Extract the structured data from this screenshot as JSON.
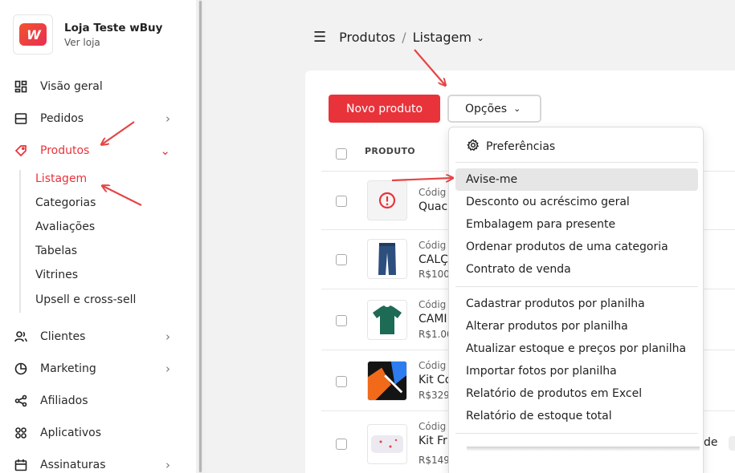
{
  "store": {
    "name": "Loja Teste wBuy",
    "link": "Ver loja",
    "logo_text": "W"
  },
  "nav": {
    "items": [
      {
        "label": "Visão geral",
        "icon": "dashboard-icon"
      },
      {
        "label": "Pedidos",
        "icon": "orders-icon",
        "chevron": "›"
      },
      {
        "label": "Produtos",
        "icon": "tag-icon",
        "chevron": "⌄"
      },
      {
        "label": "Clientes",
        "icon": "users-icon",
        "chevron": "›"
      },
      {
        "label": "Marketing",
        "icon": "pie-chart-icon",
        "chevron": "›"
      },
      {
        "label": "Afiliados",
        "icon": "share-icon"
      },
      {
        "label": "Aplicativos",
        "icon": "apps-icon"
      },
      {
        "label": "Assinaturas",
        "icon": "calendar-icon",
        "chevron": "›"
      }
    ],
    "sub_items": [
      "Listagem",
      "Categorias",
      "Avaliações",
      "Tabelas",
      "Vitrines",
      "Upsell e cross-sell"
    ]
  },
  "breadcrumb": {
    "section": "Produtos",
    "separator": "/",
    "current": "Listagem",
    "dropdown": "⌄"
  },
  "toolbar": {
    "new_product": "Novo produto",
    "options": "Opções",
    "options_chevron": "⌄"
  },
  "table": {
    "header": "PRODUTO",
    "rows": [
      {
        "code": "Códig",
        "name": "Quac",
        "price": ""
      },
      {
        "code": "Códig",
        "name": "CALÇ",
        "price": "R$100,"
      },
      {
        "code": "Códig",
        "name": "CAMI",
        "price": "R$1.00"
      },
      {
        "code": "Códig",
        "name": "Kit Co",
        "price": "R$329"
      },
      {
        "code": "Códig",
        "name": "Kit Fr",
        "price": "R$149,90"
      }
    ]
  },
  "dropdown": {
    "preferences": "Preferências",
    "group1": [
      "Avise-me",
      "Desconto ou acréscimo geral",
      "Embalagem para presente",
      "Ordenar produtos de uma categoria",
      "Contrato de venda"
    ],
    "group2": [
      "Cadastrar produtos por planilha",
      "Alterar produtos por planilha",
      "Atualizar estoque e preços por planilha",
      "Importar fotos por planilha",
      "Relatório de produtos em Excel",
      "Relatório de estoque total"
    ]
  },
  "behind_text": "de",
  "colors": {
    "accent": "#e8333b",
    "annotation_arrow": "#e64545"
  }
}
